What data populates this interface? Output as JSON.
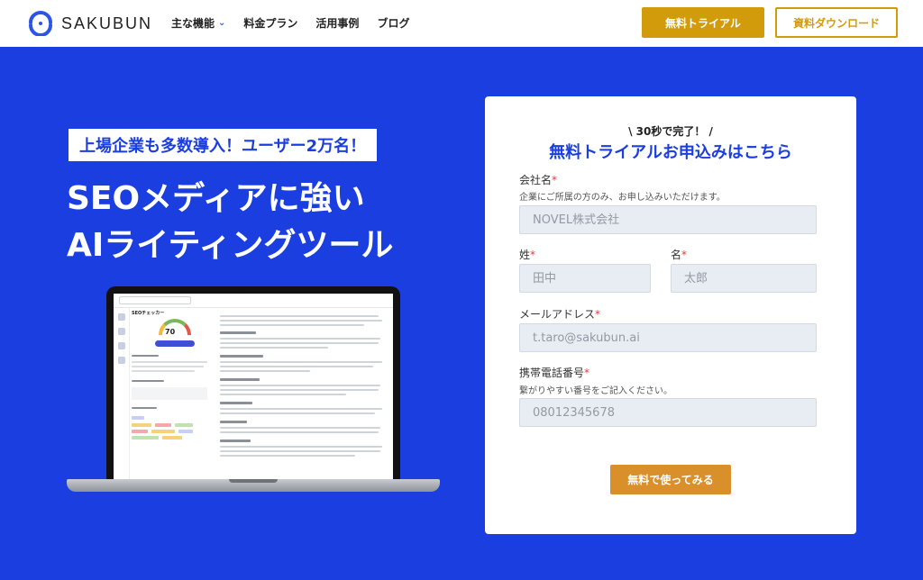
{
  "header": {
    "logo_text": "SAKUBUN",
    "nav": [
      {
        "label": "主な機能",
        "has_dropdown": true
      },
      {
        "label": "料金プラン"
      },
      {
        "label": "活用事例"
      },
      {
        "label": "ブログ"
      }
    ],
    "trial_button": "無料トライアル",
    "docs_button": "資料ダウンロード"
  },
  "hero": {
    "badge": "上場企業も多数導入！ユーザー2万名！",
    "headline_line1": "SEOメディアに強い",
    "headline_line2": "AIライティングツール"
  },
  "form": {
    "subtitle": "\\ 30秒で完了！ /",
    "title": "無料トライアルお申込みはこちら",
    "company": {
      "label": "会社名",
      "hint": "企業にご所属の方のみ、お申し込みいただけます。",
      "placeholder": "NOVEL株式会社"
    },
    "last_name": {
      "label": "姓",
      "placeholder": "田中"
    },
    "first_name": {
      "label": "名",
      "placeholder": "太郎"
    },
    "email": {
      "label": "メールアドレス",
      "placeholder": "t.taro@sakubun.ai"
    },
    "phone": {
      "label": "携帯電話番号",
      "hint": "繋がりやすい番号をご記入ください。",
      "placeholder": "08012345678"
    },
    "required_mark": "*",
    "submit": "無料で使ってみる"
  },
  "laptop_screen": {
    "panel_title": "SEOチェッカー",
    "score": "70"
  },
  "colors": {
    "brand_blue": "#1a3ee0",
    "trial_gold": "#d29b0c",
    "submit_orange": "#d9902a"
  }
}
